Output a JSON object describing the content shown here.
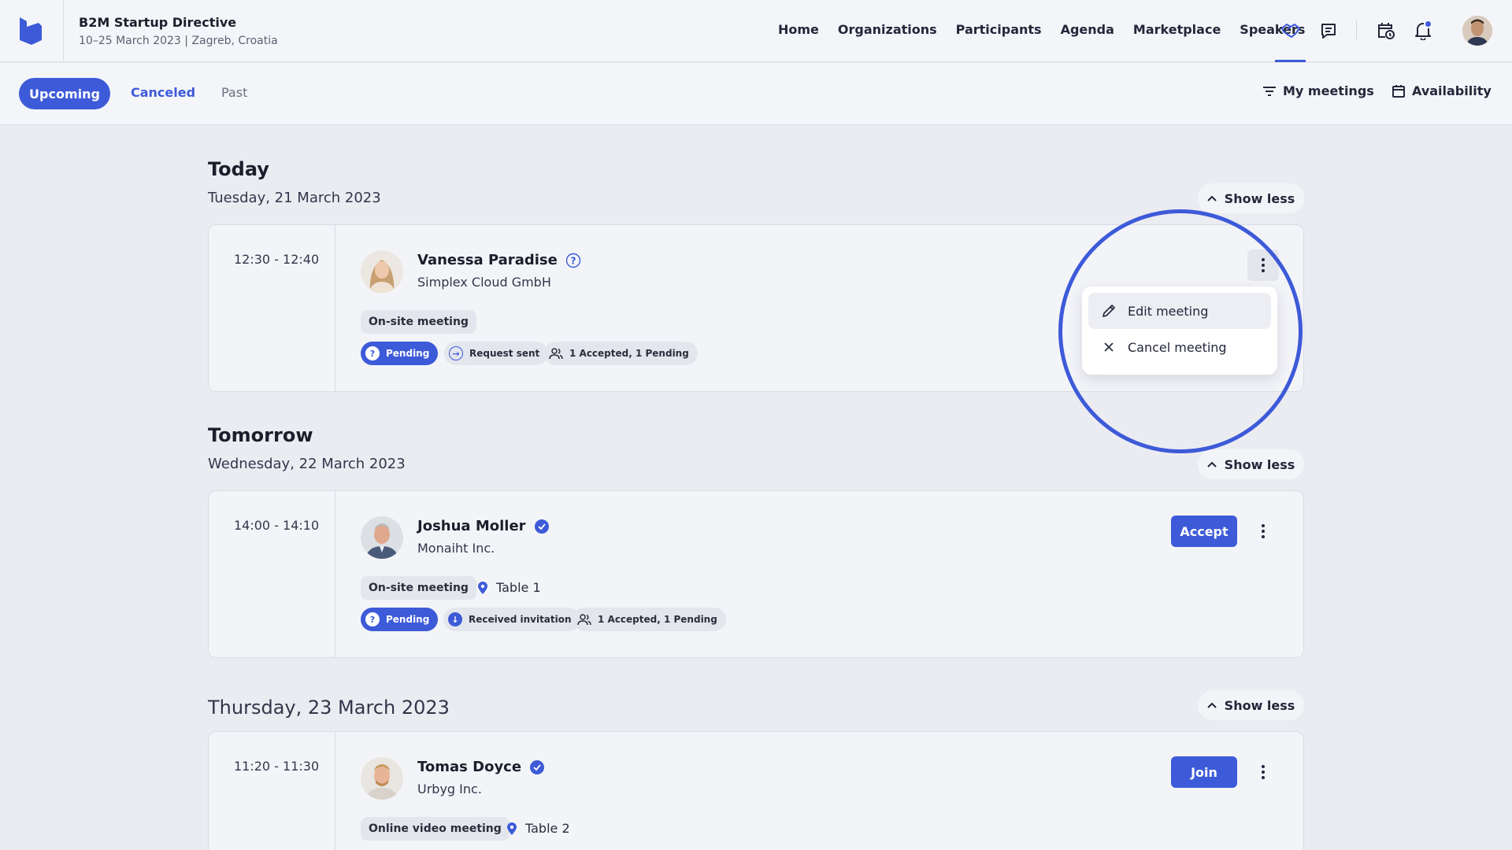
{
  "header": {
    "event_title": "B2M Startup Directive",
    "event_subtitle": "10–25 March 2023 | Zagreb, Croatia",
    "nav": [
      "Home",
      "Organizations",
      "Participants",
      "Agenda",
      "Marketplace",
      "Speakers"
    ],
    "icons": [
      "handshake-icon",
      "chat-icon",
      "calendar-clock-icon",
      "bell-icon",
      "user-avatar"
    ],
    "accent_color": "#3d5ad8"
  },
  "subnav": {
    "tabs": [
      "Upcoming",
      "Canceled",
      "Past"
    ],
    "active_tab": "Upcoming",
    "my_meetings": "My meetings",
    "availability": "Availability"
  },
  "sections": [
    {
      "title": "Today",
      "date": "Tuesday, 21 March 2023",
      "toggle": "Show less",
      "meeting": {
        "time": "12:30 - 12:40",
        "name": "Vanessa Paradise",
        "status_icon": "question-icon",
        "org": "Simplex Cloud GmbH",
        "type": "On-site meeting",
        "tags": [
          "Pending",
          "Request sent",
          "1 Accepted, 1 Pending"
        ]
      }
    },
    {
      "title": "Tomorrow",
      "date": "Wednesday, 22 March 2023",
      "toggle": "Show less",
      "meeting": {
        "time": "14:00 - 14:10",
        "name": "Joshua Moller",
        "status_icon": "verified-icon",
        "org": "Monaiht Inc.",
        "type": "On-site meeting",
        "location": "Table 1",
        "tags": [
          "Pending",
          "Received invitation",
          "1 Accepted, 1 Pending"
        ],
        "action": "Accept"
      }
    },
    {
      "title": "",
      "date": "Thursday, 23 March 2023",
      "toggle": "Show less",
      "meeting": {
        "time": "11:20 - 11:30",
        "name": "Tomas Doyce",
        "status_icon": "verified-icon",
        "org": "Urbyg Inc.",
        "type": "Online video meeting",
        "location": "Table 2",
        "action": "Join"
      }
    }
  ],
  "context_menu": {
    "items": [
      "Edit meeting",
      "Cancel meeting"
    ],
    "hovered": "Edit meeting"
  }
}
